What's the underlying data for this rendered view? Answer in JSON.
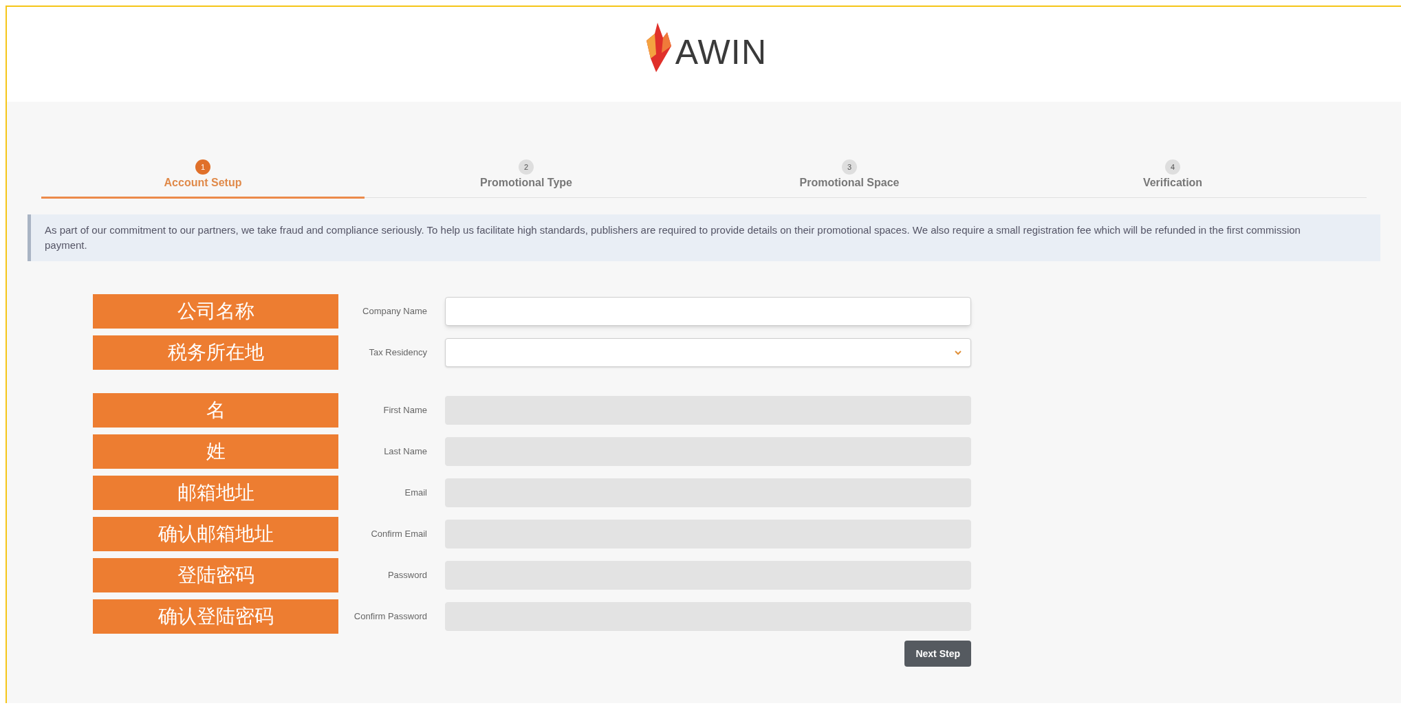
{
  "logo": {
    "text": "AWIN"
  },
  "steps": [
    {
      "number": "1",
      "label": "Account Setup",
      "selected": true
    },
    {
      "number": "2",
      "label": "Promotional Type",
      "selected": false
    },
    {
      "number": "3",
      "label": "Promotional Space",
      "selected": false
    },
    {
      "number": "4",
      "label": "Verification",
      "selected": false
    }
  ],
  "notice": "As part of our commitment to our partners, we take fraud and compliance seriously. To help us facilitate high standards, publishers are required to provide details on their promotional spaces. We also require a small registration fee which will be refunded in the first commission payment.",
  "fields": [
    {
      "annotation": "公司名称",
      "label": "Company Name",
      "kind": "text",
      "disabled": false
    },
    {
      "annotation": "税务所在地",
      "label": "Tax Residency",
      "kind": "select",
      "disabled": false
    },
    {
      "annotation": "名",
      "label": "First Name",
      "kind": "text",
      "disabled": true
    },
    {
      "annotation": "姓",
      "label": "Last Name",
      "kind": "text",
      "disabled": true
    },
    {
      "annotation": "邮箱地址",
      "label": "Email",
      "kind": "text",
      "disabled": true
    },
    {
      "annotation": "确认邮箱地址",
      "label": "Confirm Email",
      "kind": "text",
      "disabled": true
    },
    {
      "annotation": "登陆密码",
      "label": "Password",
      "kind": "text",
      "disabled": true
    },
    {
      "annotation": "确认登陆密码",
      "label": "Confirm Password",
      "kind": "text",
      "disabled": true
    }
  ],
  "next_button": "Next Step"
}
